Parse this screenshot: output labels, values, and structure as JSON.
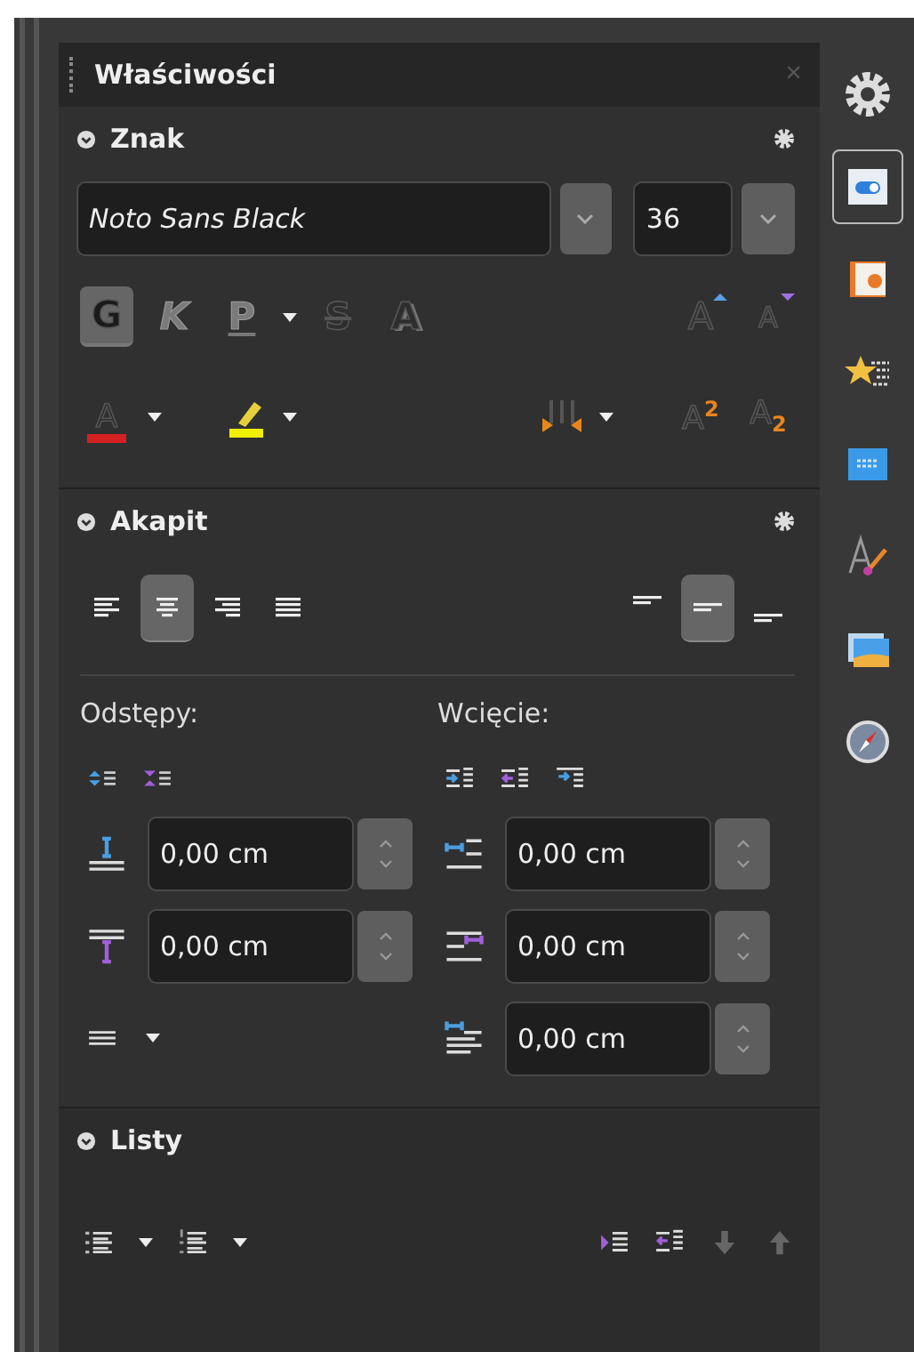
{
  "panel": {
    "title": "Właściwości",
    "close": "×"
  },
  "character": {
    "title": "Znak",
    "font_name": "Noto Sans Black",
    "font_size": "36",
    "style_buttons": [
      {
        "kind": "bold",
        "label": "G",
        "selected": true
      },
      {
        "kind": "italic",
        "label": "K",
        "selected": false
      },
      {
        "kind": "underline",
        "label": "P",
        "selected": false
      },
      {
        "kind": "strike",
        "label": "S",
        "selected": false
      },
      {
        "kind": "shadow",
        "label": "A",
        "selected": false
      }
    ],
    "size_buttons": [
      {
        "kind": "grow",
        "label": "A"
      },
      {
        "kind": "shrink",
        "label": "A"
      }
    ],
    "color_buttons": [
      {
        "kind": "font_color",
        "label": "A",
        "color": "#d42020"
      },
      {
        "kind": "highlight",
        "color": "#f0f000"
      }
    ],
    "script_buttons": [
      {
        "label": "A$^{2}$"
      },
      {
        "label": "A$_{2}$"
      }
    ]
  },
  "paragraph": {
    "title": "Akapit",
    "align_buttons": [
      {
        "kind": "left",
        "selected": false
      },
      {
        "kind": "center",
        "selected": true
      },
      {
        "kind": "right",
        "selected": false
      },
      {
        "kind": "justify",
        "selected": false
      }
    ],
    "valign_buttons": [
      {
        "kind": "top",
        "selected": false
      },
      {
        "kind": "middle",
        "selected": true
      },
      {
        "kind": "bottom",
        "selected": false
      }
    ],
    "spacing_label": "Odstępy:",
    "indent_label": "Wcięcie:",
    "spacing_fields": [
      {
        "kind": "above",
        "value": "0,00 cm"
      },
      {
        "kind": "below",
        "value": "0,00 cm"
      }
    ],
    "indent_fields": [
      {
        "kind": "before",
        "value": "0,00 cm"
      },
      {
        "kind": "after",
        "value": "0,00 cm"
      },
      {
        "kind": "first",
        "value": "0,00 cm"
      }
    ]
  },
  "lists": {
    "title": "Listy"
  },
  "tabbar": {
    "items": [
      {
        "kind": "settings",
        "selected": false
      },
      {
        "kind": "properties",
        "selected": true
      },
      {
        "kind": "styles",
        "selected": false
      },
      {
        "kind": "gallery",
        "selected": false
      },
      {
        "kind": "navigator",
        "selected": false
      },
      {
        "kind": "style_inspector",
        "selected": false
      },
      {
        "kind": "images",
        "selected": false
      },
      {
        "kind": "compass",
        "selected": false
      }
    ]
  }
}
